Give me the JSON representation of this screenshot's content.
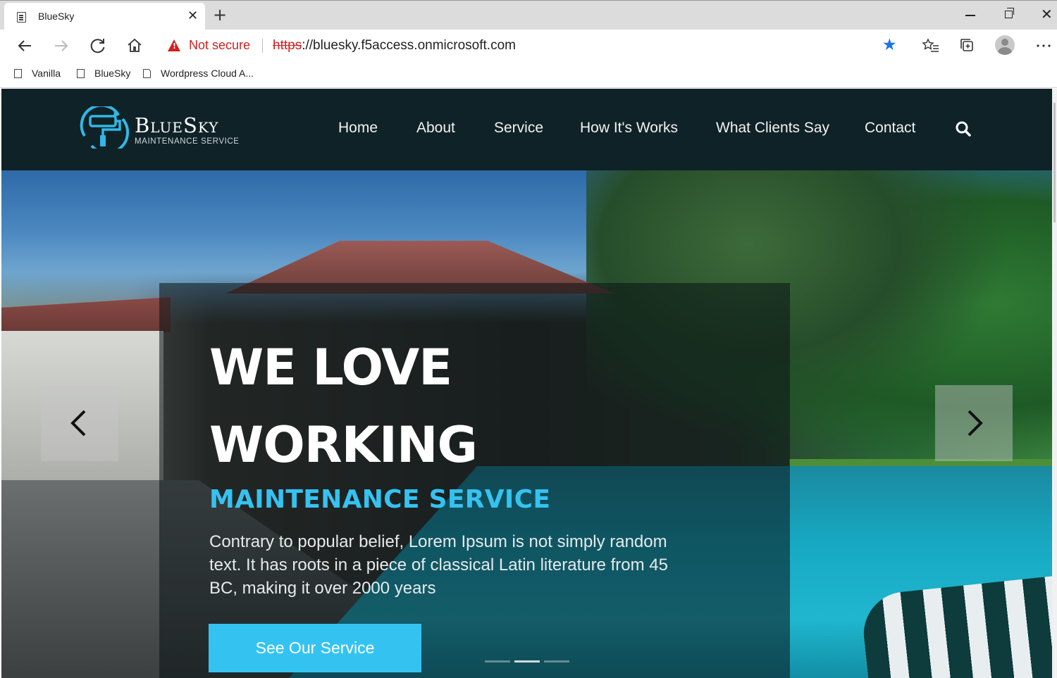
{
  "browser": {
    "tab_title": "BlueSky",
    "tab_close": "✕",
    "new_tab": "+",
    "window_close": "✕",
    "security_label": "Not secure",
    "url_scheme": "https",
    "url_rest": "://bluesky.f5access.onmicrosoft.com",
    "bookmarks": [
      "Vanilla",
      "BlueSky",
      "Wordpress Cloud A..."
    ],
    "icons": [
      "back-icon",
      "forward-icon",
      "refresh-icon",
      "home-icon",
      "warning-icon",
      "star-icon",
      "favorites-icon",
      "collections-icon",
      "profile-icon",
      "more-icon"
    ]
  },
  "site": {
    "logo_title": "BlueSky",
    "logo_subtitle": "MAINTENANCE SERVICE",
    "menu": [
      "Home",
      "About",
      "Service",
      "How It's Works",
      "What Clients Say",
      "Contact"
    ],
    "hero": {
      "headline_line1": "WE LOVE",
      "headline_line2": "WORKING",
      "subheadline": "MAINTENANCE SERVICE",
      "paragraph": "Contrary to popular belief, Lorem Ipsum is not simply random text. It has roots in a piece of classical Latin literature from 45 BC, making it over 2000 years",
      "cta_label": "See Our Service",
      "slide_count": 3,
      "active_slide": 2
    },
    "colors": {
      "header_bg": "#0f2227",
      "accent": "#34c3f1",
      "warning": "#d21f1f",
      "bookmark_star": "#1a73e8"
    }
  }
}
